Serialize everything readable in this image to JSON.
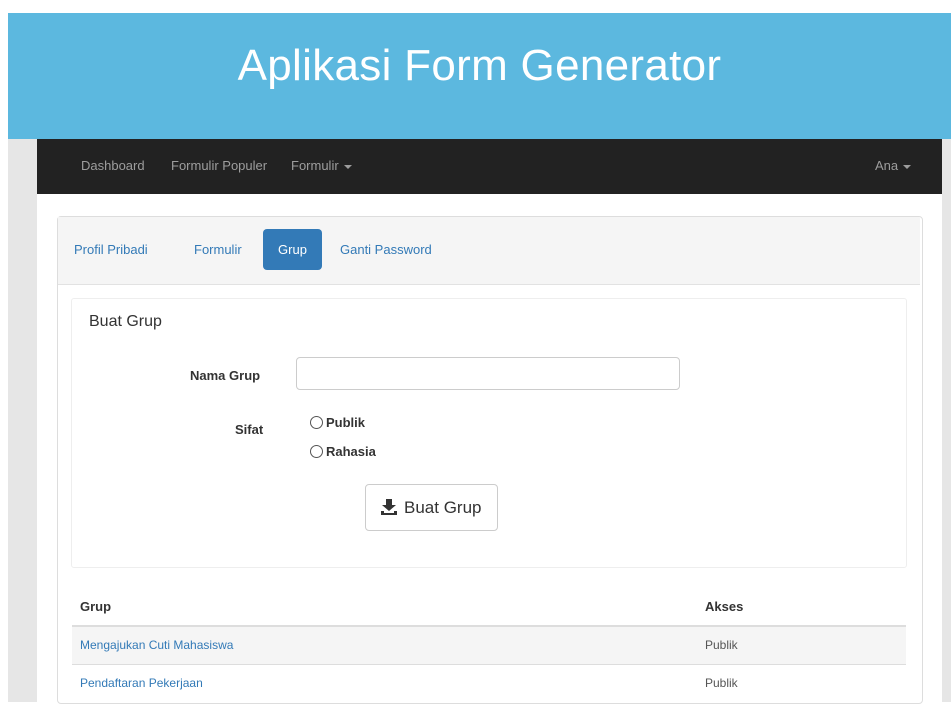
{
  "app": {
    "title": "Aplikasi Form Generator"
  },
  "navbar": {
    "items": [
      {
        "label": "Dashboard"
      },
      {
        "label": "Formulir Populer"
      },
      {
        "label": "Formulir"
      }
    ],
    "user": "Ana"
  },
  "tabs": [
    {
      "label": "Profil Pribadi",
      "active": false
    },
    {
      "label": "Formulir",
      "active": false
    },
    {
      "label": "Grup",
      "active": true
    },
    {
      "label": "Ganti Password",
      "active": false
    }
  ],
  "form": {
    "title": "Buat Grup",
    "name_label": "Nama Grup",
    "name_value": "",
    "type_label": "Sifat",
    "options": [
      {
        "label": "Publik",
        "checked": false
      },
      {
        "label": "Rahasia",
        "checked": false
      }
    ],
    "submit_label": "Buat Grup",
    "submit_icon": "download-icon"
  },
  "table": {
    "headers": [
      "Grup",
      "Akses"
    ],
    "rows": [
      {
        "grup": "Mengajukan Cuti Mahasiswa",
        "akses": "Publik"
      },
      {
        "grup": "Pendaftaran Pekerjaan",
        "akses": "Publik"
      }
    ]
  },
  "colors": {
    "banner": "#5cb8df",
    "navbar": "#222222",
    "link": "#337ab7",
    "active_tab": "#337ab7"
  }
}
